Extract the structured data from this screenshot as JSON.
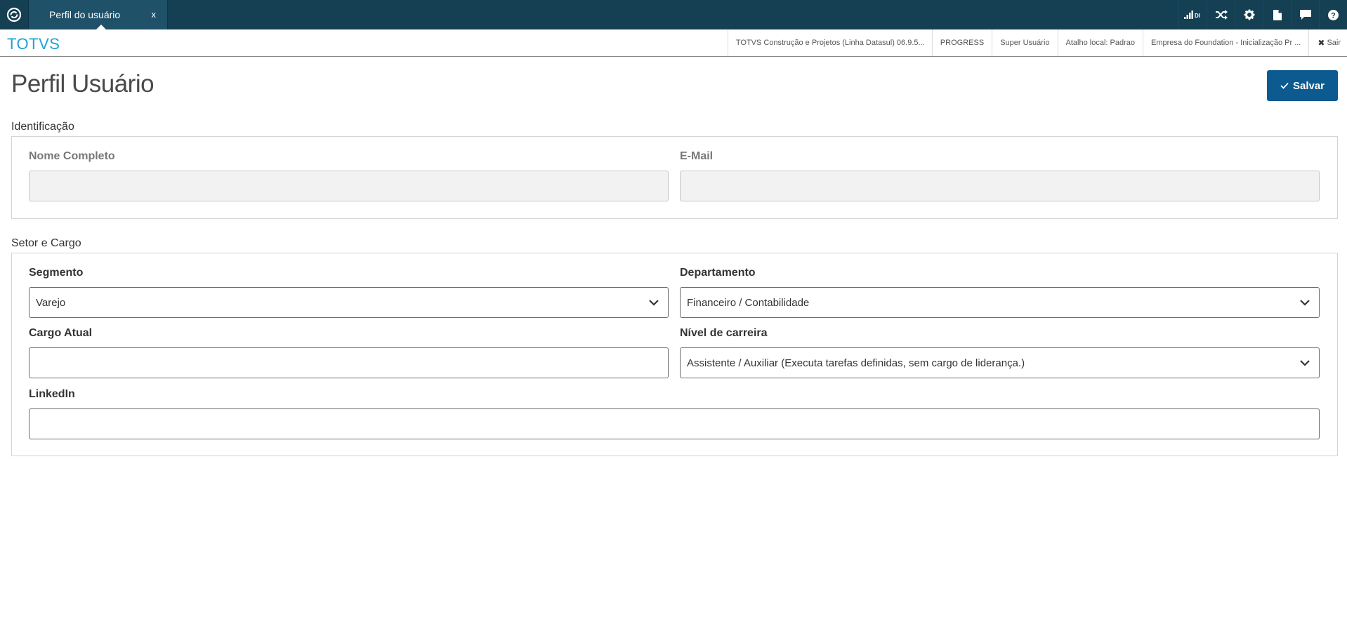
{
  "topbar": {
    "tab_label": "Perfil do usuário",
    "tab_close": "x",
    "icons": [
      "home-icon",
      "signal-icon",
      "shuffle-icon",
      "gear-icon",
      "document-icon",
      "chat-icon",
      "help-icon"
    ],
    "signal_badge": "DI"
  },
  "header": {
    "brand": "TOTVS",
    "info": [
      "TOTVS Construção e Projetos (Linha Datasul) 06.9.5...",
      "PROGRESS",
      "Super Usuário",
      "Atalho local: Padrao",
      "Empresa do Foundation - Inicialização Pr ..."
    ],
    "logout_label": "Sair"
  },
  "page": {
    "title": "Perfil Usuário",
    "save_label": "Salvar"
  },
  "identificacao": {
    "title": "Identificação",
    "nome_label": "Nome Completo",
    "nome_value": "",
    "email_label": "E-Mail",
    "email_value": ""
  },
  "setor": {
    "title": "Setor e Cargo",
    "segmento_label": "Segmento",
    "segmento_value": "Varejo",
    "departamento_label": "Departamento",
    "departamento_value": "Financeiro / Contabilidade",
    "cargo_label": "Cargo Atual",
    "cargo_value": "",
    "nivel_label": "Nível de carreira",
    "nivel_value": "Assistente / Auxiliar (Executa tarefas definidas, sem cargo de liderança.)",
    "linkedin_label": "LinkedIn",
    "linkedin_value": ""
  },
  "colors": {
    "topbar": "#153f52",
    "tab": "#1f5169",
    "brand": "#1ea3d4",
    "primary_button": "#0c5a8f"
  }
}
